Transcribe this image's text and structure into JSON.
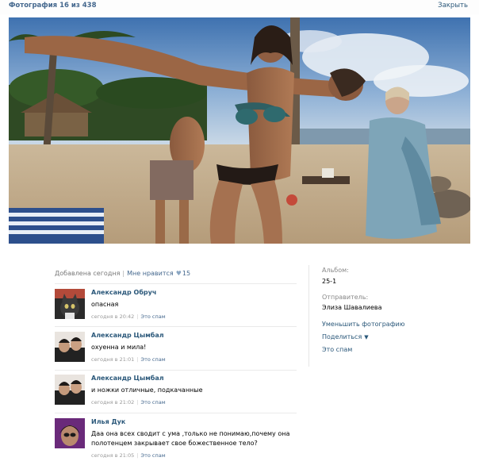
{
  "header": {
    "title": "Фотография 16 из 438",
    "close_label": "Закрыть"
  },
  "likes": {
    "added": "Добавлена сегодня",
    "like_label": "Мне нравится",
    "count": "15"
  },
  "comments": [
    {
      "author": "Александр Обруч",
      "text": "опасная",
      "time": "сегодня в 20:42",
      "spam": "Это спам"
    },
    {
      "author": "Александр Цымбал",
      "text": "охуенна и мила!",
      "time": "сегодня в 21:01",
      "spam": "Это спам"
    },
    {
      "author": "Александр Цымбал",
      "text": "и ножки отличные, подкачанные",
      "time": "сегодня в 21:02",
      "spam": "Это спам"
    },
    {
      "author": "Илья Дук",
      "text": "Даа она всех сводит с ума ,только не понимаю,почему она полотенцем закрывает свое божественное тело?",
      "time": "сегодня в 21:05",
      "spam": "Это спам"
    }
  ],
  "sidebar": {
    "album_label": "Альбом:",
    "album_value": "25-1",
    "sender_label": "Отправитель:",
    "sender_value": "Элиза Шавалиева",
    "shrink_link": "Уменьшить фотографию",
    "share_link": "Поделиться",
    "spam_link": "Это спам"
  },
  "colors": {
    "link": "#2b587a",
    "header_link": "#45688e"
  }
}
